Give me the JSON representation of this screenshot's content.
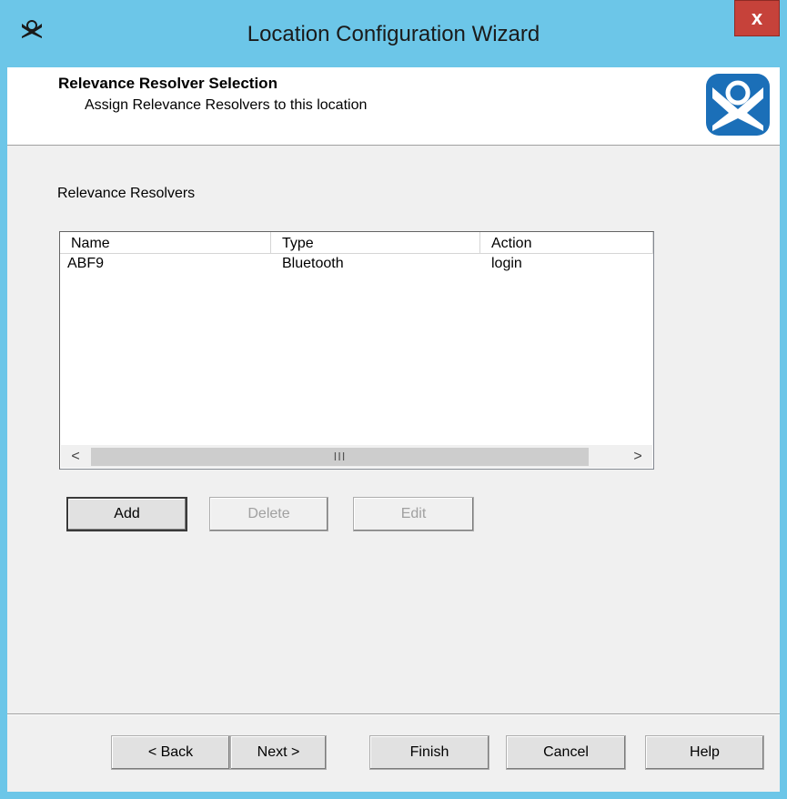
{
  "window": {
    "title": "Location Configuration Wizard",
    "close_label": "x"
  },
  "header": {
    "title": "Relevance Resolver Selection",
    "subtitle": "Assign Relevance Resolvers to this location"
  },
  "section_label": "Relevance Resolvers",
  "list": {
    "columns": [
      "Name",
      "Type",
      "Action"
    ],
    "rows": [
      {
        "name": "ABF9",
        "type": "Bluetooth",
        "action": "login"
      }
    ],
    "scroll_left": "<",
    "scroll_right": ">",
    "scroll_grip": "III"
  },
  "actions": {
    "add": "Add",
    "delete": "Delete",
    "edit": "Edit"
  },
  "footer": {
    "back": "< Back",
    "next": "Next >",
    "finish": "Finish",
    "cancel": "Cancel",
    "help": "Help"
  },
  "colors": {
    "titlebar": "#6cc6e8",
    "close": "#c6423a",
    "logo_blue": "#1b6fb8"
  }
}
